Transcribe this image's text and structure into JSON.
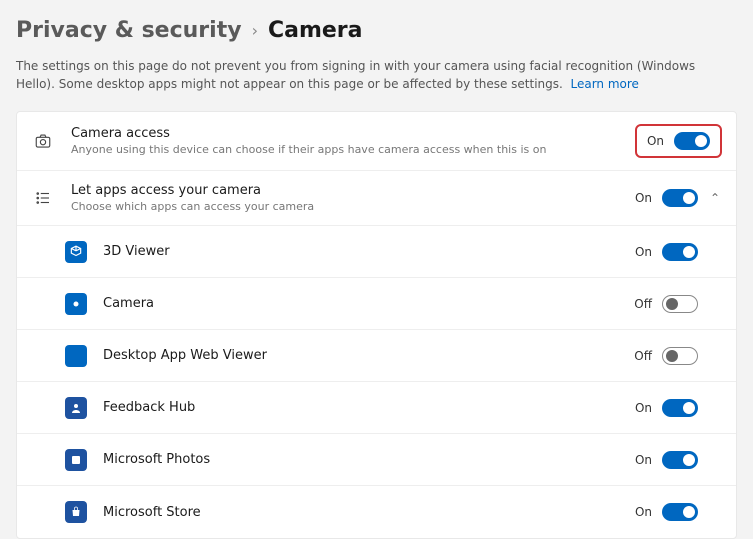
{
  "breadcrumb": {
    "parent": "Privacy & security",
    "current": "Camera"
  },
  "description": "The settings on this page do not prevent you from signing in with your camera using facial recognition (Windows Hello). Some desktop apps might not appear on this page or be affected by these settings.",
  "learn_more": "Learn more",
  "camera_access": {
    "title": "Camera access",
    "subtitle": "Anyone using this device can choose if their apps have camera access when this is on",
    "state": "On"
  },
  "let_apps": {
    "title": "Let apps access your camera",
    "subtitle": "Choose which apps can access your camera",
    "state": "On"
  },
  "apps": [
    {
      "name": "3D Viewer",
      "state": "On"
    },
    {
      "name": "Camera",
      "state": "Off"
    },
    {
      "name": "Desktop App Web Viewer",
      "state": "Off"
    },
    {
      "name": "Feedback Hub",
      "state": "On"
    },
    {
      "name": "Microsoft Photos",
      "state": "On"
    },
    {
      "name": "Microsoft Store",
      "state": "On"
    }
  ]
}
